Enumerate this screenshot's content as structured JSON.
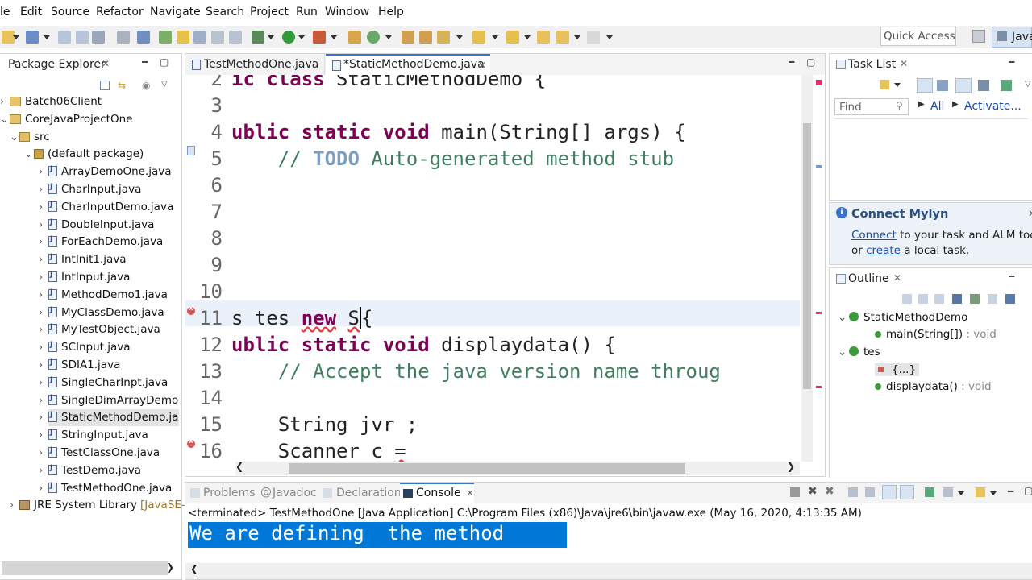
{
  "menu": [
    "le",
    "Edit",
    "Source",
    "Refactor",
    "Navigate",
    "Search",
    "Project",
    "Run",
    "Window",
    "Help"
  ],
  "toolbar": {
    "quick_access": "Quick Access",
    "perspective": "Java"
  },
  "package_explorer": {
    "title": "Package Explorer",
    "items": [
      {
        "label": "Batch06Client",
        "kind": "project",
        "level": 0,
        "expanded": false
      },
      {
        "label": "CoreJavaProjectOne",
        "kind": "project",
        "level": 0,
        "expanded": true
      },
      {
        "label": "src",
        "kind": "src",
        "level": 1,
        "expanded": true
      },
      {
        "label": "(default package)",
        "kind": "package",
        "level": 2,
        "expanded": true
      },
      {
        "label": "ArrayDemoOne.java",
        "kind": "file",
        "level": 3
      },
      {
        "label": "CharInput.java",
        "kind": "file",
        "level": 3
      },
      {
        "label": "CharInputDemo.java",
        "kind": "file",
        "level": 3
      },
      {
        "label": "DoubleInput.java",
        "kind": "file",
        "level": 3
      },
      {
        "label": "ForEachDemo.java",
        "kind": "file",
        "level": 3
      },
      {
        "label": "IntInit1.java",
        "kind": "file",
        "level": 3
      },
      {
        "label": "IntInput.java",
        "kind": "file",
        "level": 3
      },
      {
        "label": "MethodDemo1.java",
        "kind": "file",
        "level": 3
      },
      {
        "label": "MyClassDemo.java",
        "kind": "file",
        "level": 3
      },
      {
        "label": "MyTestObject.java",
        "kind": "file",
        "level": 3
      },
      {
        "label": "SCInput.java",
        "kind": "file",
        "level": 3
      },
      {
        "label": "SDIA1.java",
        "kind": "file",
        "level": 3
      },
      {
        "label": "SingleCharInpt.java",
        "kind": "file",
        "level": 3
      },
      {
        "label": "SingleDimArrayDemo",
        "kind": "file",
        "level": 3
      },
      {
        "label": "StaticMethodDemo.ja",
        "kind": "file",
        "level": 3,
        "selected": true
      },
      {
        "label": "StringInput.java",
        "kind": "file",
        "level": 3
      },
      {
        "label": "TestClassOne.java",
        "kind": "file",
        "level": 3
      },
      {
        "label": "TestDemo.java",
        "kind": "file",
        "level": 3
      },
      {
        "label": "TestMethodOne.java",
        "kind": "file",
        "level": 3
      },
      {
        "label": "JRE System Library",
        "suffix": "[JavaSE-",
        "kind": "lib",
        "level": 1,
        "expanded": false
      }
    ]
  },
  "editor": {
    "tabs": [
      {
        "label": "TestMethodOne.java",
        "active": false
      },
      {
        "label": "*StaticMethodDemo.java",
        "active": true
      }
    ],
    "lines": [
      {
        "num": "2",
        "text": "ic class StaticMethodDemo {"
      },
      {
        "num": "3",
        "text": ""
      },
      {
        "num": "4",
        "text": "ublic static void main(String[] args) {"
      },
      {
        "num": "5",
        "text": "    // TODO Auto-generated method stub"
      },
      {
        "num": "6",
        "text": ""
      },
      {
        "num": "7",
        "text": ""
      },
      {
        "num": "8",
        "text": ""
      },
      {
        "num": "9",
        "text": ""
      },
      {
        "num": "10",
        "text": ""
      },
      {
        "num": "11",
        "text": "s tes new S{"
      },
      {
        "num": "12",
        "text": "ublic static void displaydata() {"
      },
      {
        "num": "13",
        "text": "    // Accept the java version name throug"
      },
      {
        "num": "14",
        "text": ""
      },
      {
        "num": "15",
        "text": "    String jvr ;"
      },
      {
        "num": "16",
        "text": "    Scanner c ="
      }
    ]
  },
  "task_list": {
    "title": "Task List",
    "find_placeholder": "Find",
    "all_label": "All",
    "activate_label": "Activate..."
  },
  "mylyn": {
    "title": "Connect Mylyn",
    "connect": "Connect",
    "line1_rest": " to your task and ALM tools",
    "line2_pre": "or ",
    "create": "create",
    "line2_rest": " a local task."
  },
  "outline": {
    "title": "Outline",
    "items": [
      {
        "label": "StaticMethodDemo",
        "level": 0
      },
      {
        "label": "main(String[])",
        "suffix": " : void",
        "level": 1
      },
      {
        "label": "tes",
        "level": 0
      },
      {
        "label": "{...}",
        "level": 1
      },
      {
        "label": "displaydata()",
        "suffix": " : void",
        "level": 1
      }
    ]
  },
  "bottom": {
    "tabs": [
      "Problems",
      "Javadoc",
      "Declaration",
      "Console"
    ],
    "active_tab": "Console",
    "terminated": "<terminated> TestMethodOne [Java Application] C:\\Program Files (x86)\\Java\\jre6\\bin\\javaw.exe (May 16, 2020, 4:13:35 AM)",
    "output": "We are defining  the method"
  }
}
